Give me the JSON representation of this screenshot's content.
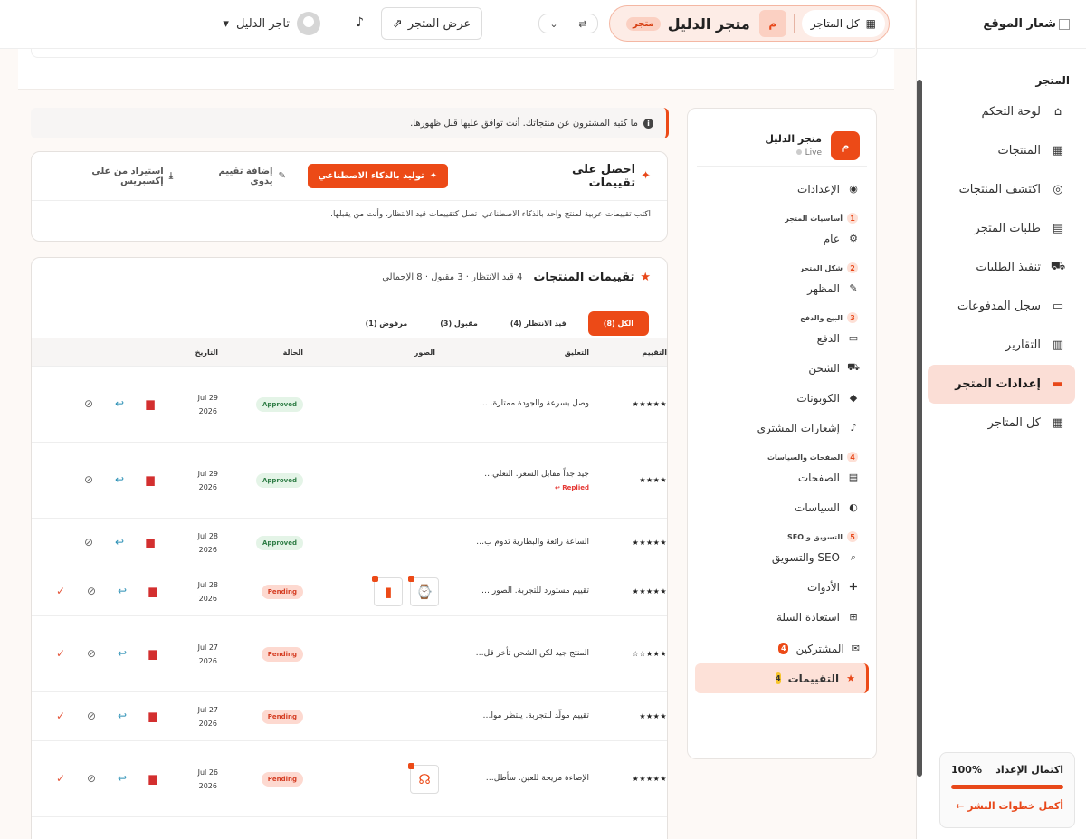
{
  "nav": {
    "logo_alt": "شعار الموقع",
    "section": "المتجر",
    "items": [
      {
        "label": "لوحة التحكم",
        "icon": "home-icon",
        "glyph": "⌂"
      },
      {
        "label": "المنتجات",
        "icon": "box-icon",
        "glyph": "▦"
      },
      {
        "label": "اكتشف المنتجات",
        "icon": "compass-icon",
        "glyph": "◎"
      },
      {
        "label": "طلبات المتجر",
        "icon": "receipt-icon",
        "glyph": "▤"
      },
      {
        "label": "تنفيذ الطلبات",
        "icon": "truck-icon",
        "glyph": "⛟"
      },
      {
        "label": "سجل المدفوعات",
        "icon": "money-icon",
        "glyph": "▭"
      },
      {
        "label": "التقارير",
        "icon": "chart-icon",
        "glyph": "▥"
      },
      {
        "label": "إعدادات المتجر",
        "icon": "store-icon",
        "glyph": "▬"
      },
      {
        "label": "كل المتاجر",
        "icon": "grid-icon",
        "glyph": "▦"
      }
    ],
    "setup": {
      "title": "اكتمال الإعداد",
      "percent": "100%",
      "progress": 1.0,
      "link": "أكمل خطوات النشر ←"
    }
  },
  "topbar": {
    "all_stores": "كل المتاجر",
    "store_initial": "م",
    "store_name": "متجر الدليل",
    "store_badge": "متجر",
    "view_store": "عرض المتجر",
    "user_name": "تاجر الدليل"
  },
  "subnav": {
    "store_initial": "م",
    "store_name": "متجر الدليل",
    "store_status": "Live",
    "settings": "الإعدادات",
    "groups": [
      {
        "num": "1",
        "title": "أساسيات المتجر",
        "items": [
          {
            "label": "عام",
            "glyph": "⚙"
          }
        ]
      },
      {
        "num": "2",
        "title": "شكل المتجر",
        "items": [
          {
            "label": "المظهر",
            "glyph": "✎"
          }
        ]
      },
      {
        "num": "3",
        "title": "البيع والدفع",
        "items": [
          {
            "label": "الدفع",
            "glyph": "▭"
          },
          {
            "label": "الشحن",
            "glyph": "⛟"
          },
          {
            "label": "الكوبونات",
            "glyph": "◆"
          },
          {
            "label": "إشعارات المشتري",
            "glyph": "♪"
          }
        ]
      },
      {
        "num": "4",
        "title": "الصفحات والسياسات",
        "items": [
          {
            "label": "الصفحات",
            "glyph": "▤"
          },
          {
            "label": "السياسات",
            "glyph": "◐"
          }
        ]
      },
      {
        "num": "5",
        "title": "التسويق و SEO",
        "items": [
          {
            "label": "SEO والتسويق",
            "glyph": "⌕"
          },
          {
            "label": "الأدوات",
            "glyph": "✚"
          },
          {
            "label": "استعادة السلة",
            "glyph": "⊞"
          }
        ]
      }
    ],
    "subscribers": "المشتركين",
    "subscribers_count": "4",
    "reviews": "التقييمات",
    "reviews_count": "4"
  },
  "info": "ما كتبه المشترون عن منتجاتك. أنت توافق عليها قبل ظهورها.",
  "get_reviews": {
    "title": "احصل على تقييمات",
    "ai_button": "توليد بالذكاء الاصطناعي",
    "manual_button": "إضافة تقييم يدوي",
    "import_button": "استيراد من علي إكسبريس",
    "subtitle": "اكتب تقييمات عربية لمنتج واحد بالذكاء الاصطناعي. تصل كتقييمات قيد الانتظار، وأنت من يقبلها."
  },
  "reviews": {
    "title": "تقييمات المنتجات",
    "meta": "4 قيد الانتظار · 3 مقبول · 8 الإجمالي",
    "tabs": [
      "الكل (8)",
      "قيد الانتظار (4)",
      "مقبول (3)",
      "مرفوض (1)"
    ],
    "columns": {
      "rating": "التقييم",
      "comment": "التعليق",
      "images": "الصور",
      "status": "الحالة",
      "date": "التاريخ"
    },
    "rows": [
      {
        "stars": "★★★★★",
        "comment": "وصل بسرعة والجودة ممتازة. …",
        "status": "Approved",
        "kind": "ok",
        "date1": "Jul 29",
        "date2": "2026",
        "replied": ""
      },
      {
        "stars": "★★★★",
        "comment": "جيد جداً مقابل السعر. التعلي…",
        "status": "Approved",
        "kind": "ok",
        "date1": "Jul 29",
        "date2": "2026",
        "replied": "Replied ↩"
      },
      {
        "stars": "★★★★★",
        "comment": "الساعة رائعة والبطارية تدوم ب…",
        "status": "Approved",
        "kind": "ok",
        "date1": "Jul 28",
        "date2": "2026",
        "replied": ""
      },
      {
        "stars": "★★★★★",
        "comment": "تقييم مستورد للتجربة. الصور …",
        "status": "Pending",
        "kind": "pend",
        "date1": "Jul 28",
        "date2": "2026",
        "replied": ""
      },
      {
        "stars": "★★★☆☆",
        "comment": "المنتج جيد لكن الشحن تأخر قل…",
        "status": "Pending",
        "kind": "pend",
        "date1": "Jul 27",
        "date2": "2026",
        "replied": ""
      },
      {
        "stars": "★★★★",
        "comment": "تقييم مولّد للتجربة. ينتظر موا…",
        "status": "Pending",
        "kind": "pend",
        "date1": "Jul 27",
        "date2": "2026",
        "replied": ""
      },
      {
        "stars": "★★★★★",
        "comment": "الإضاءة مريحة للعين. سأطل…",
        "status": "Pending",
        "kind": "pend",
        "date1": "Jul 26",
        "date2": "2026",
        "replied": ""
      }
    ]
  }
}
